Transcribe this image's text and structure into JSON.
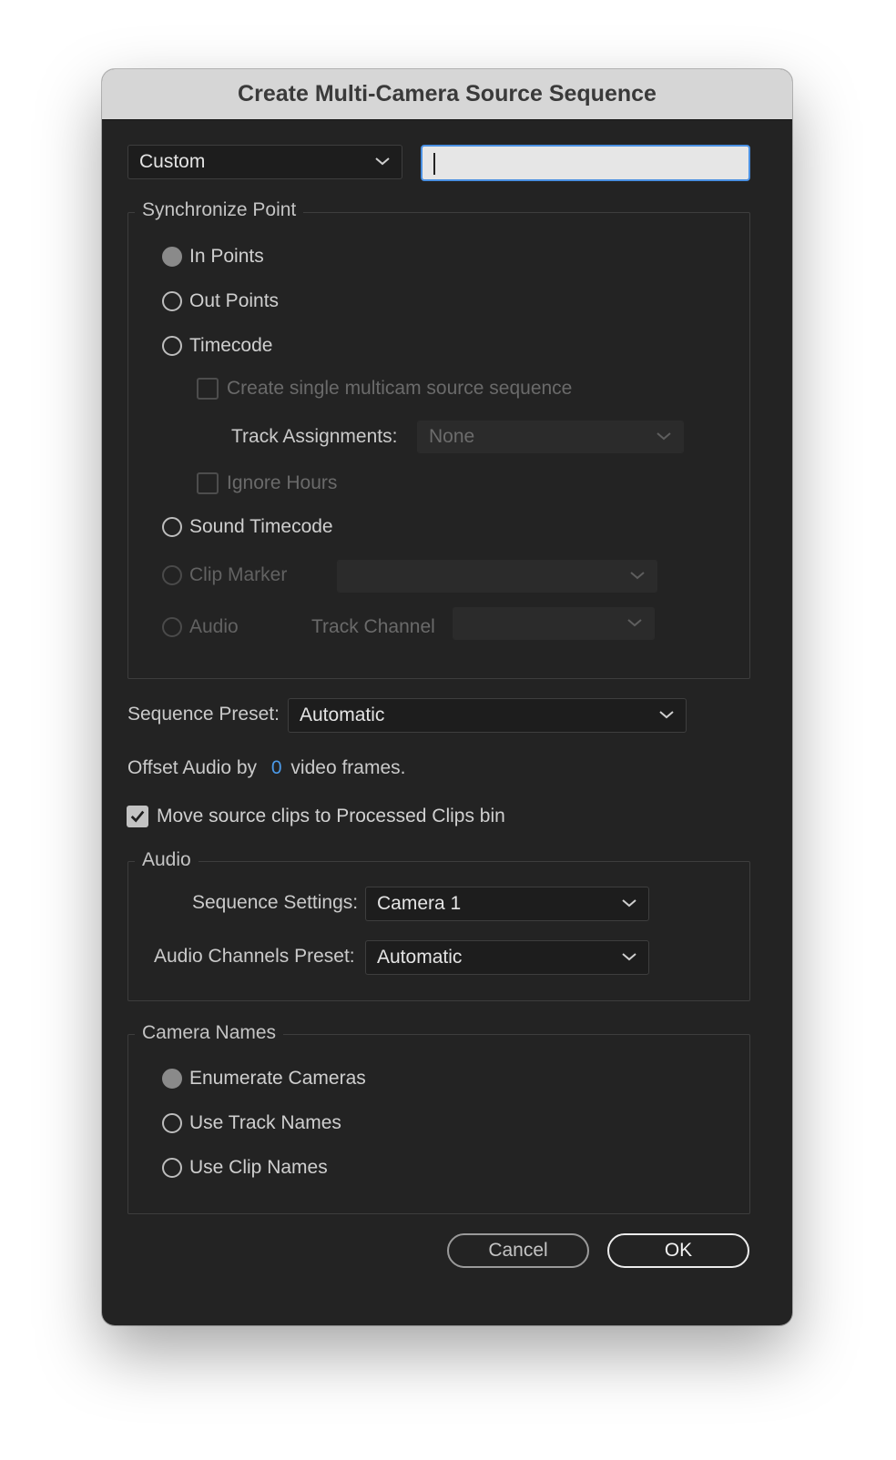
{
  "dialog": {
    "title": "Create Multi-Camera Source Sequence"
  },
  "top": {
    "preset": "Custom",
    "name_value": ""
  },
  "sync": {
    "legend": "Synchronize Point",
    "in_points": "In Points",
    "out_points": "Out Points",
    "timecode": "Timecode",
    "create_single": "Create single multicam source sequence",
    "track_assignments_label": "Track Assignments:",
    "track_assignments_value": "None",
    "ignore_hours": "Ignore Hours",
    "sound_timecode": "Sound Timecode",
    "clip_marker": "Clip Marker",
    "clip_marker_value": "",
    "audio": "Audio",
    "track_channel_label": "Track Channel",
    "track_channel_value": "",
    "selected": "In Points"
  },
  "sequence_preset": {
    "label": "Sequence Preset:",
    "value": "Automatic"
  },
  "offset": {
    "prefix": "Offset Audio by",
    "value": "0",
    "suffix": "video frames."
  },
  "move_clips": {
    "label": "Move source clips to Processed Clips bin",
    "checked": true
  },
  "audio_group": {
    "legend": "Audio",
    "sequence_settings_label": "Sequence Settings:",
    "sequence_settings_value": "Camera 1",
    "channels_preset_label": "Audio Channels Preset:",
    "channels_preset_value": "Automatic"
  },
  "camera_names": {
    "legend": "Camera Names",
    "enumerate": "Enumerate Cameras",
    "track_names": "Use Track Names",
    "clip_names": "Use Clip Names",
    "selected": "Enumerate Cameras"
  },
  "buttons": {
    "cancel": "Cancel",
    "ok": "OK"
  },
  "colors": {
    "accent": "#4a90e2",
    "dialog_bg": "#232323",
    "titlebar_bg": "#d6d6d6"
  },
  "icons": {
    "dropdown": "chevron-down-icon",
    "checkmark": "checkmark-icon"
  }
}
